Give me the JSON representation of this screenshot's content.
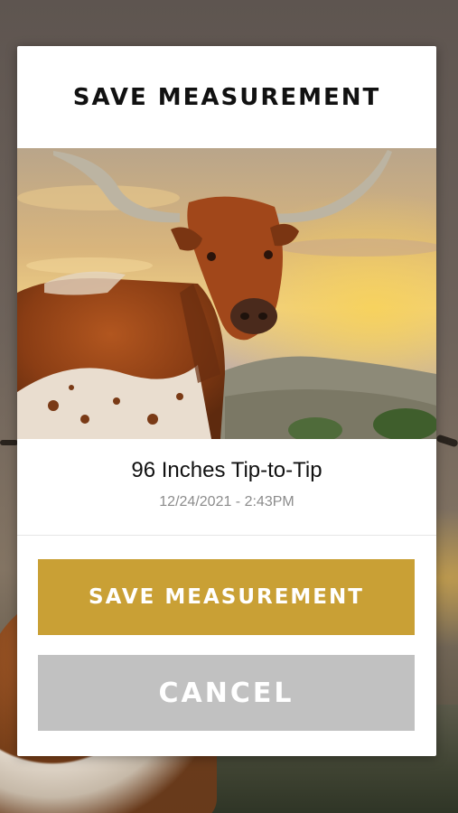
{
  "dialog": {
    "title": "SAVE MEASUREMENT",
    "photo_alt": "longhorn steer photo",
    "measurement": "96 Inches Tip-to-Tip",
    "timestamp": "12/24/2021 - 2:43PM"
  },
  "actions": {
    "save_label": "SAVE MEASUREMENT",
    "cancel_label": "CANCEL"
  },
  "colors": {
    "save_button": "#c9a035",
    "cancel_button": "#c1c1c1",
    "dialog_bg": "#ffffff"
  }
}
